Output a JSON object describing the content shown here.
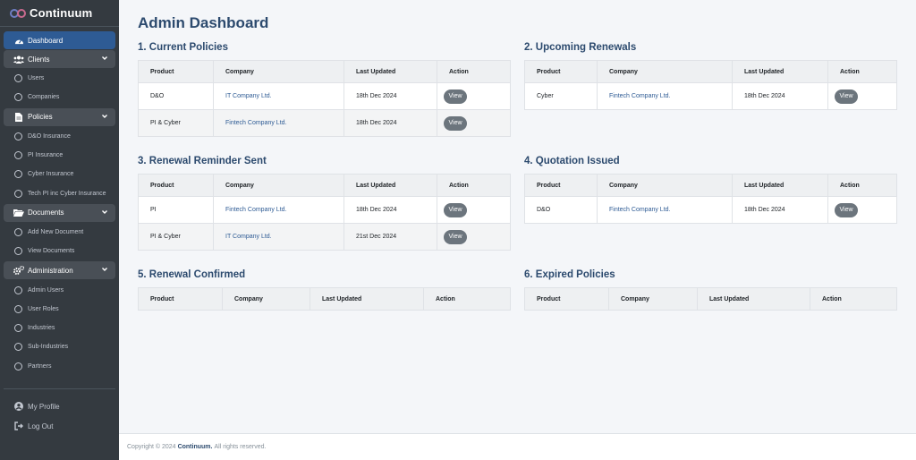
{
  "brand": {
    "name": "Continuum"
  },
  "sidebar": {
    "dashboard": "Dashboard",
    "clients": {
      "label": "Clients",
      "items": [
        "Users",
        "Companies"
      ]
    },
    "policies": {
      "label": "Policies",
      "items": [
        "D&O Insurance",
        "PI Insurance",
        "Cyber Insurance",
        "Tech PI inc Cyber Insurance"
      ]
    },
    "documents": {
      "label": "Documents",
      "items": [
        "Add New Document",
        "View Documents"
      ]
    },
    "administration": {
      "label": "Administration",
      "items": [
        "Admin Users",
        "User Roles",
        "Industries",
        "Sub-Industries",
        "Partners"
      ]
    },
    "profile": "My Profile",
    "logout": "Log Out"
  },
  "page": {
    "title": "Admin Dashboard"
  },
  "headers": {
    "product": "Product",
    "company": "Company",
    "last_updated": "Last Updated",
    "action": "Action"
  },
  "view_label": "View",
  "panels": {
    "current": {
      "title": "1. Current Policies",
      "rows": [
        {
          "product": "D&O",
          "company": "IT Company Ltd.",
          "updated": "18th Dec 2024"
        },
        {
          "product": "PI & Cyber",
          "company": "Fintech Company Ltd.",
          "updated": "18th Dec 2024"
        }
      ]
    },
    "renewals": {
      "title": "2. Upcoming Renewals",
      "rows": [
        {
          "product": "Cyber",
          "company": "Fintech Company Ltd.",
          "updated": "18th Dec 2024"
        }
      ]
    },
    "reminder": {
      "title": "3. Renewal Reminder Sent",
      "rows": [
        {
          "product": "PI",
          "company": "Fintech Company Ltd.",
          "updated": "18th Dec 2024"
        },
        {
          "product": "PI & Cyber",
          "company": "IT Company Ltd.",
          "updated": "21st Dec 2024"
        }
      ]
    },
    "quotation": {
      "title": "4. Quotation Issued",
      "rows": [
        {
          "product": "D&O",
          "company": "Fintech Company Ltd.",
          "updated": "18th Dec 2024"
        }
      ]
    },
    "confirmed": {
      "title": "5. Renewal Confirmed",
      "rows": []
    },
    "expired": {
      "title": "6. Expired Policies",
      "rows": []
    }
  },
  "footer": {
    "prefix": "Copyright © 2024",
    "brand": "Continuum.",
    "suffix": "All rights reserved."
  },
  "colors": {
    "sidebar_bg": "#343a40",
    "active": "#2e5b94",
    "heading": "#2c4a6e",
    "link": "#2e5b94"
  }
}
